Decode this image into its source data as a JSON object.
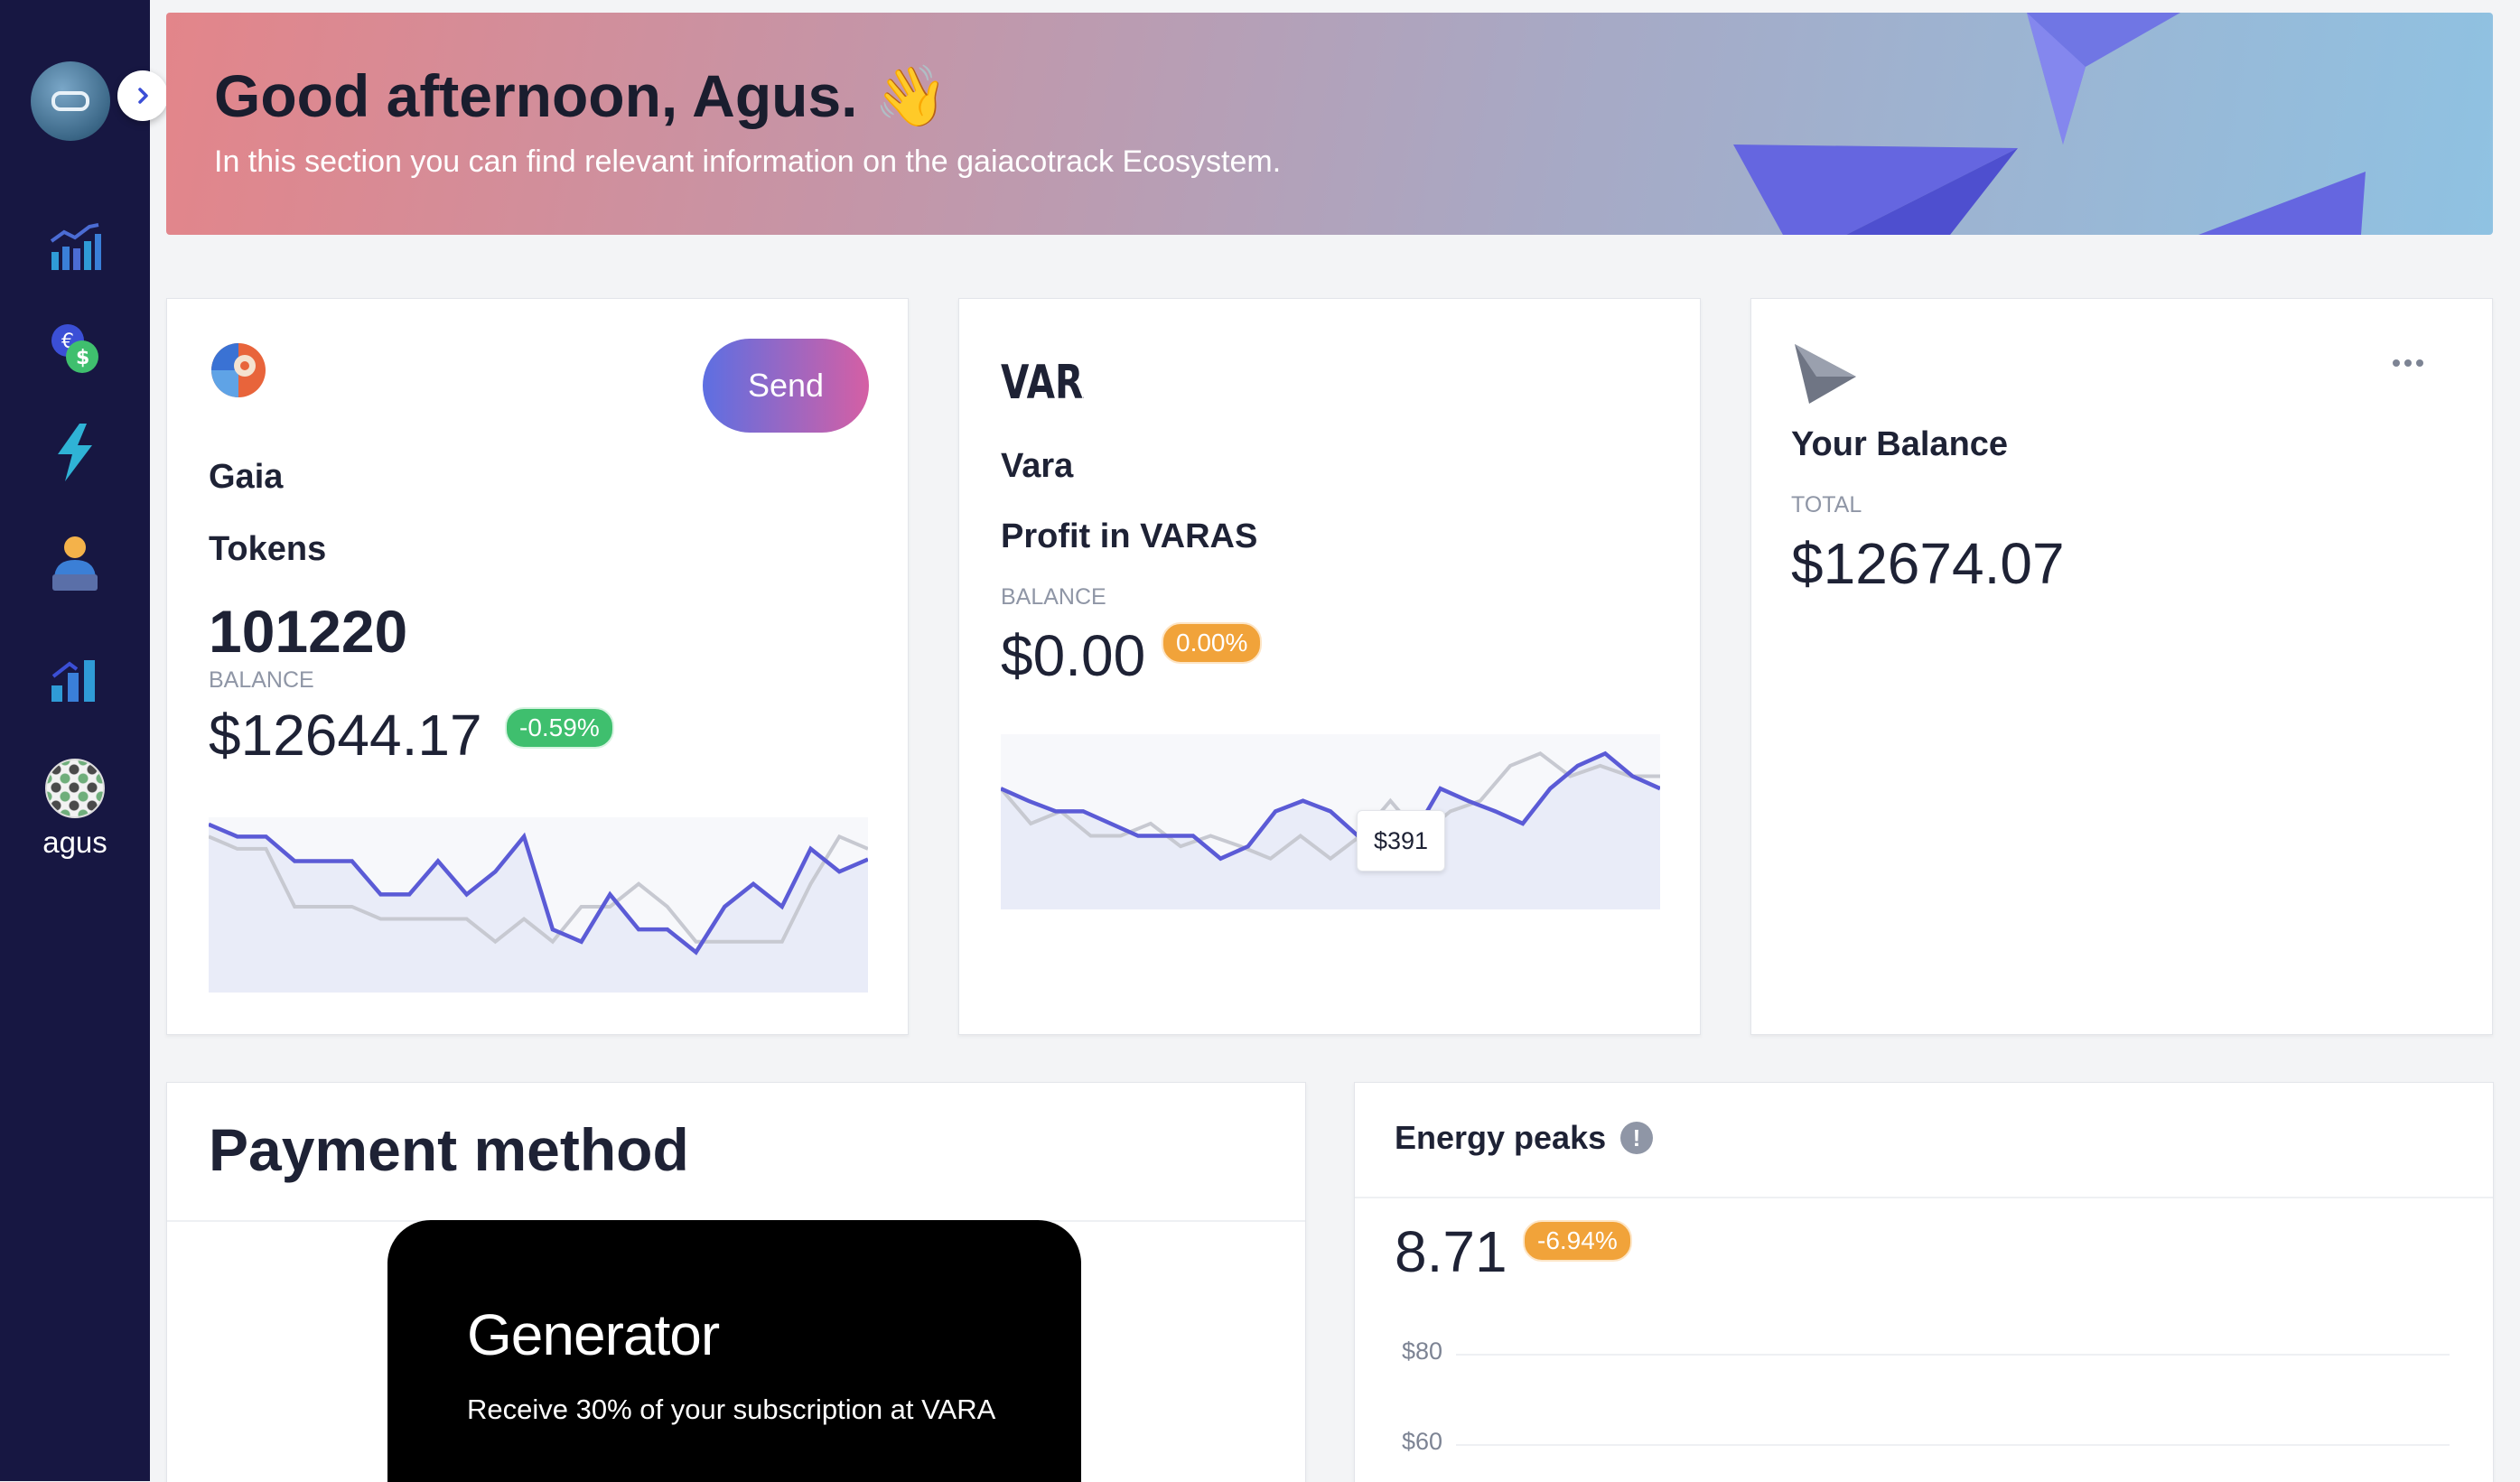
{
  "sidebar": {
    "user_name": "agus",
    "icons": [
      "analytics-icon",
      "currency-exchange-icon",
      "lightning-icon",
      "user-laptop-icon",
      "growth-bars-icon"
    ]
  },
  "hero": {
    "greeting": "Good afternoon, Agus. 👋",
    "subtitle": "In this section you can find relevant information on the gaiacotrack Ecosystem."
  },
  "gaia_card": {
    "title_line1": "Gaia",
    "title_line2": "Tokens",
    "tokens": "101220",
    "balance_label": "BALANCE",
    "balance": "$12644.17",
    "change": "-0.59%",
    "send_label": "Send"
  },
  "vara_card": {
    "logo_text": "VARA",
    "title_line1": "Vara",
    "title_line2": "Profit in VARAS",
    "balance_label": "BALANCE",
    "balance": "$0.00",
    "change": "0.00%",
    "tooltip": "$391"
  },
  "balance_card": {
    "title": "Your Balance",
    "total_label": "TOTAL",
    "total": "$12674.07"
  },
  "payment": {
    "title": "Payment method",
    "card_title": "Generator",
    "card_subtitle": "Receive 30% of your subscription at VARA"
  },
  "energy": {
    "title": "Energy peaks",
    "value": "8.71",
    "change": "-6.94%",
    "ticks": [
      "$80",
      "$60"
    ]
  },
  "colors": {
    "sidebar_bg": "#171742",
    "accent_line": "#5b5bd6",
    "badge_green": "#3fbf6e",
    "badge_orange": "#f1a33a"
  },
  "chart_data": [
    {
      "type": "line",
      "name": "gaia-sparkline",
      "series": [
        {
          "values": [
            96,
            89,
            89,
            75,
            75,
            75,
            56,
            56,
            75,
            56,
            69,
            89,
            36,
            29,
            56,
            36,
            36,
            23,
            49,
            62,
            49,
            82,
            69,
            76
          ]
        },
        {
          "values": [
            89,
            82,
            82,
            49,
            49,
            49,
            42,
            42,
            42,
            42,
            29,
            42,
            29,
            49,
            49,
            62,
            49,
            29,
            29,
            29,
            29,
            62,
            89,
            82
          ]
        }
      ]
    },
    {
      "type": "line",
      "name": "vara-sparkline",
      "series": [
        {
          "values": [
            69,
            62,
            56,
            56,
            49,
            42,
            42,
            42,
            29,
            36,
            56,
            62,
            56,
            42,
            29,
            42,
            69,
            62,
            56,
            49,
            69,
            82,
            89,
            76,
            69
          ]
        },
        {
          "values": [
            69,
            49,
            56,
            42,
            42,
            49,
            36,
            42,
            36,
            29,
            42,
            29,
            42,
            62,
            42,
            56,
            62,
            82,
            89,
            76,
            82,
            76,
            76
          ]
        }
      ]
    }
  ]
}
